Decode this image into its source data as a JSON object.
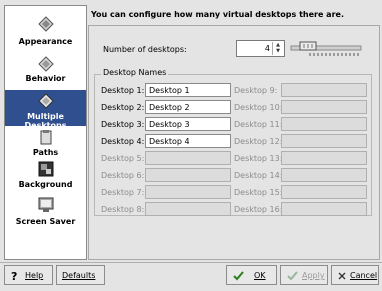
{
  "sidebar": {
    "items": [
      {
        "label": "Appearance",
        "icon": "appearance-icon"
      },
      {
        "label": "Behavior",
        "icon": "behavior-icon"
      },
      {
        "label": "Multiple Desktops",
        "icon": "multiple-desktops-icon",
        "selected": true
      },
      {
        "label": "Paths",
        "icon": "paths-icon"
      },
      {
        "label": "Background",
        "icon": "background-icon"
      },
      {
        "label": "Screen Saver",
        "icon": "screen-saver-icon"
      }
    ]
  },
  "main": {
    "heading": "You can configure how many virtual desktops there are.",
    "number_label": "Number of desktops:",
    "number_value": "4",
    "group_title": "Desktop Names",
    "desktops": [
      {
        "label": "Desktop 1:",
        "value": "Desktop 1",
        "enabled": true
      },
      {
        "label": "Desktop 2:",
        "value": "Desktop 2",
        "enabled": true
      },
      {
        "label": "Desktop 3:",
        "value": "Desktop 3",
        "enabled": true
      },
      {
        "label": "Desktop 4:",
        "value": "Desktop 4",
        "enabled": true
      },
      {
        "label": "Desktop 5:",
        "value": "",
        "enabled": false
      },
      {
        "label": "Desktop 6:",
        "value": "",
        "enabled": false
      },
      {
        "label": "Desktop 7:",
        "value": "",
        "enabled": false
      },
      {
        "label": "Desktop 8:",
        "value": "",
        "enabled": false
      },
      {
        "label": "Desktop 9:",
        "value": "",
        "enabled": false
      },
      {
        "label": "Desktop 10:",
        "value": "",
        "enabled": false
      },
      {
        "label": "Desktop 11:",
        "value": "",
        "enabled": false
      },
      {
        "label": "Desktop 12:",
        "value": "",
        "enabled": false
      },
      {
        "label": "Desktop 13:",
        "value": "",
        "enabled": false
      },
      {
        "label": "Desktop 14:",
        "value": "",
        "enabled": false
      },
      {
        "label": "Desktop 15:",
        "value": "",
        "enabled": false
      },
      {
        "label": "Desktop 16:",
        "value": "",
        "enabled": false
      }
    ]
  },
  "buttons": {
    "help": "Help",
    "defaults": "Defaults",
    "ok": "OK",
    "apply": "Apply",
    "cancel": "Cancel"
  },
  "colors": {
    "selection": "#2f4f8f",
    "ok_check": "#2e7d1f"
  }
}
